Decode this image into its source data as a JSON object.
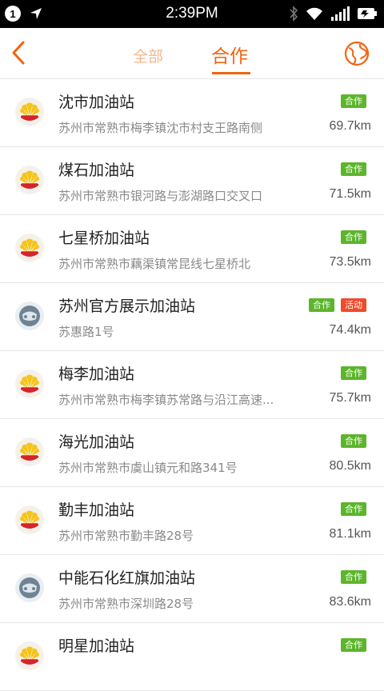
{
  "status_bar": {
    "time": "2:39PM",
    "notification_count": "1"
  },
  "nav": {
    "tab_all": "全部",
    "tab_coop": "合作"
  },
  "colors": {
    "accent": "#f0640f",
    "coop_badge": "#5cb52b",
    "activity_badge": "#ef4a2a"
  },
  "stations": [
    {
      "name": "沈市加油站",
      "address": "苏州市常熟市梅李镇沈市村支王路南侧",
      "distance": "69.7km",
      "icon": "petrochina-logo",
      "badges": [
        "合作"
      ]
    },
    {
      "name": "煤石加油站",
      "address": "苏州市常熟市银河路与澎湖路口交叉口",
      "distance": "71.5km",
      "icon": "petrochina-logo",
      "badges": [
        "合作"
      ]
    },
    {
      "name": "七星桥加油站",
      "address": "苏州市常熟市藕渠镇常昆线七星桥北",
      "distance": "73.5km",
      "icon": "petrochina-logo",
      "badges": [
        "合作"
      ]
    },
    {
      "name": "苏州官方展示加油站",
      "address": "苏惠路1号",
      "distance": "74.4km",
      "icon": "generic-station-icon",
      "badges": [
        "合作",
        "活动"
      ]
    },
    {
      "name": "梅李加油站",
      "address": "苏州市常熟市梅李镇苏常路与沿江高速...",
      "distance": "75.7km",
      "icon": "petrochina-logo",
      "badges": [
        "合作"
      ]
    },
    {
      "name": "海光加油站",
      "address": "苏州市常熟市虞山镇元和路341号",
      "distance": "80.5km",
      "icon": "petrochina-logo",
      "badges": [
        "合作"
      ]
    },
    {
      "name": "勤丰加油站",
      "address": "苏州市常熟市勤丰路28号",
      "distance": "81.1km",
      "icon": "petrochina-logo",
      "badges": [
        "合作"
      ]
    },
    {
      "name": "中能石化红旗加油站",
      "address": "苏州市常熟市深圳路28号",
      "distance": "83.6km",
      "icon": "generic-station-icon",
      "badges": [
        "合作"
      ]
    },
    {
      "name": "明星加油站",
      "address": "",
      "distance": "",
      "icon": "petrochina-logo",
      "badges": [
        "合作"
      ]
    }
  ]
}
